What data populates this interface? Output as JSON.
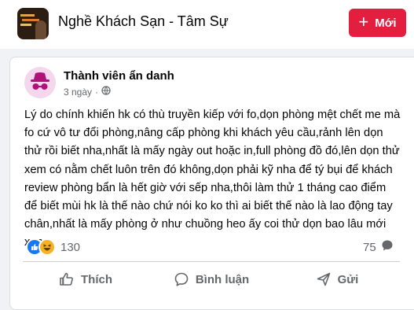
{
  "header": {
    "group_title": "Nghề Khách Sạn - Tâm Sự",
    "new_button_plus": "+",
    "new_button_label": "Mới"
  },
  "post": {
    "author": "Thành viên ẩn danh",
    "time": "3 ngày",
    "separator": "·",
    "text": "Lý do chính khiến hk có thù truyền kiếp với fo,dọn phòng mệt chết me mà fo cứ vô tư đổi phòng,nâng cấp phòng khi khách yêu cầu,rảnh lên dọn thử rồi biết nha,nhất là mấy ngày out hoặc in,full phòng đồ đó,lên dọn thử xem có nằm chết luôn trên đó không,dọn phải kỹ nha để tý bụi để khách review phòng bẩn là hết giờ với sếp nha,thôi làm thử 1 tháng cao điểm để biết mùi hk là thế nào chứ nói ko ko thì ai biết thế nào là lao động tay chân,nhất là mấy phòng ở như chuồng heo ấy coi thử dọn bao lâu mới xong.",
    "reaction_count": "130",
    "comment_count": "75"
  },
  "actions": {
    "like": "Thích",
    "comment": "Bình luận",
    "share": "Gửi"
  },
  "colors": {
    "new_button": "#e41e3f",
    "like_blue": "#1877f2",
    "haha_yellow": "#f7b125",
    "secondary_text": "#65676b"
  },
  "icons": [
    "plus-icon",
    "globe-icon",
    "like-reaction-icon",
    "haha-reaction-icon",
    "comment-bubble-icon",
    "thumbs-up-icon",
    "chat-icon",
    "share-icon"
  ]
}
